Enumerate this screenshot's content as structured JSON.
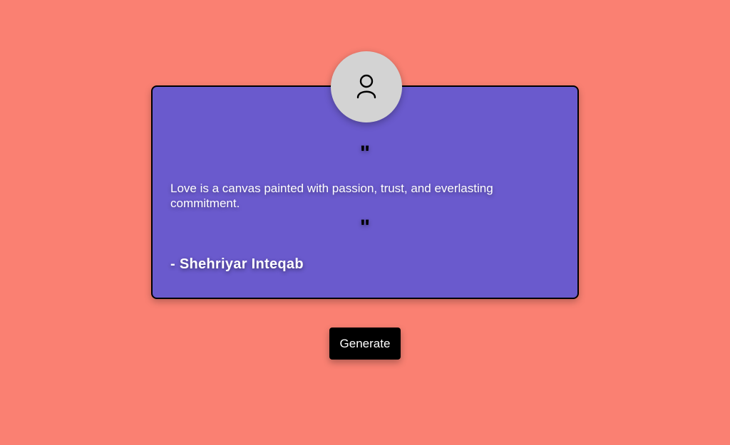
{
  "card": {
    "open_quote": "\"",
    "quote_text": "Love is a canvas painted with passion, trust, and everlasting commitment.",
    "close_quote": "\"",
    "author": "- Shehriyar Inteqab"
  },
  "avatar": {
    "icon": "user-icon"
  },
  "controls": {
    "generate_label": "Generate"
  },
  "colors": {
    "background": "#fa8072",
    "card": "#6a5acd",
    "avatar": "#d3d3d3",
    "button": "#000000"
  }
}
